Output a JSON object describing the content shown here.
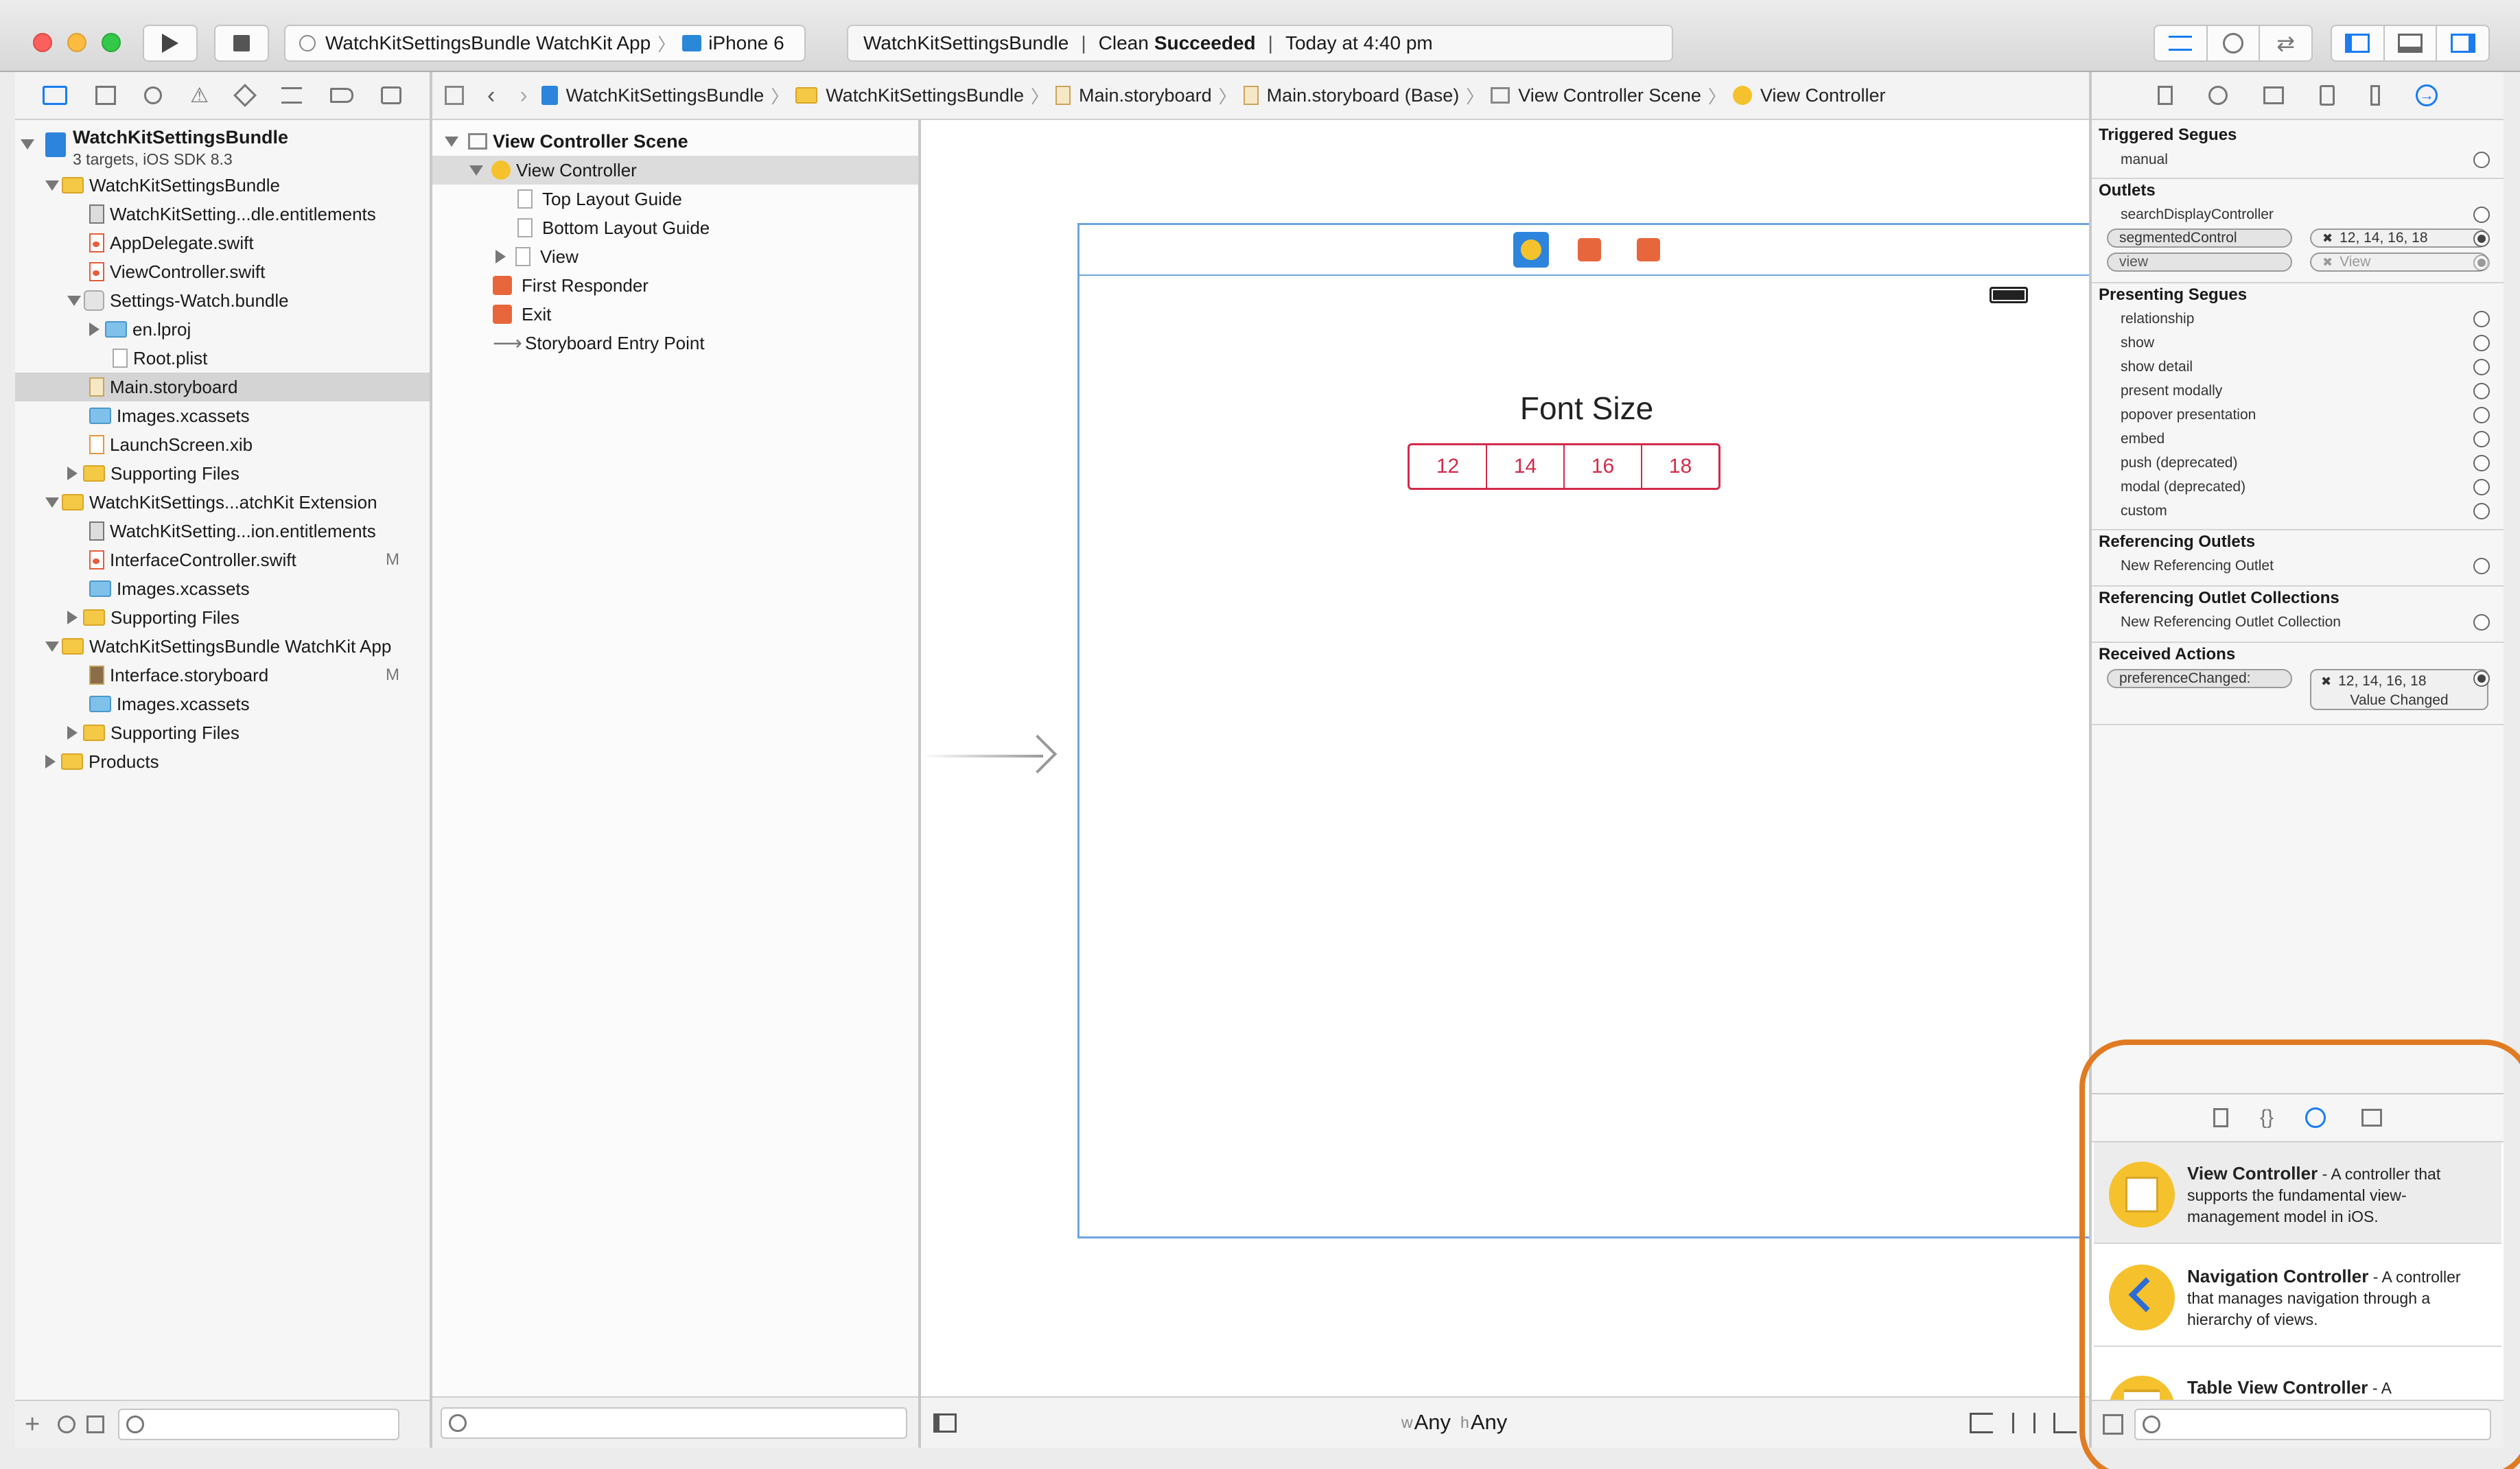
{
  "toolbar": {
    "scheme": "WatchKitSettingsBundle WatchKit App",
    "device": "iPhone 6",
    "status_project": "WatchKitSettingsBundle",
    "status_prefix": "Clean",
    "status_result": "Succeeded",
    "status_time": "Today at 4:40 pm"
  },
  "navigator": {
    "project_name": "WatchKitSettingsBundle",
    "project_subtitle": "3 targets, iOS SDK 8.3",
    "items": [
      {
        "label": "WatchKitSettingsBundle",
        "icon": "folder-icon"
      },
      {
        "label": "WatchKitSetting...dle.entitlements",
        "icon": "entitlements-icon"
      },
      {
        "label": "AppDelegate.swift",
        "icon": "swift-file-icon"
      },
      {
        "label": "ViewController.swift",
        "icon": "swift-file-icon"
      },
      {
        "label": "Settings-Watch.bundle",
        "icon": "bundle-icon"
      },
      {
        "label": "en.lproj",
        "icon": "blue-folder-icon"
      },
      {
        "label": "Root.plist",
        "icon": "plist-icon"
      },
      {
        "label": "Main.storyboard",
        "icon": "storyboard-icon"
      },
      {
        "label": "Images.xcassets",
        "icon": "assets-icon"
      },
      {
        "label": "LaunchScreen.xib",
        "icon": "xib-icon"
      },
      {
        "label": "Supporting Files",
        "icon": "folder-icon"
      },
      {
        "label": "WatchKitSettings...atchKit Extension",
        "icon": "folder-icon"
      },
      {
        "label": "WatchKitSetting...ion.entitlements",
        "icon": "entitlements-icon"
      },
      {
        "label": "InterfaceController.swift",
        "icon": "swift-file-icon",
        "badge": "M"
      },
      {
        "label": "Images.xcassets",
        "icon": "assets-icon"
      },
      {
        "label": "Supporting Files",
        "icon": "folder-icon"
      },
      {
        "label": "WatchKitSettingsBundle WatchKit App",
        "icon": "folder-icon"
      },
      {
        "label": "Interface.storyboard",
        "icon": "storyboard-icon",
        "badge": "M"
      },
      {
        "label": "Images.xcassets",
        "icon": "assets-icon"
      },
      {
        "label": "Supporting Files",
        "icon": "folder-icon"
      },
      {
        "label": "Products",
        "icon": "folder-icon"
      }
    ]
  },
  "breadcrumb": [
    "WatchKitSettingsBundle",
    "WatchKitSettingsBundle",
    "Main.storyboard",
    "Main.storyboard (Base)",
    "View Controller Scene",
    "View Controller"
  ],
  "outline": {
    "scene": "View Controller Scene",
    "items": [
      "View Controller",
      "Top Layout Guide",
      "Bottom Layout Guide",
      "View",
      "First Responder",
      "Exit",
      "Storyboard Entry Point"
    ]
  },
  "canvas": {
    "label": "Font Size",
    "segments": [
      "12",
      "14",
      "16",
      "18"
    ],
    "size_class_w": "w",
    "size_class_w_value": "Any",
    "size_class_h": "h",
    "size_class_h_value": "Any"
  },
  "inspector": {
    "triggered_segues": "Triggered Segues",
    "manual": "manual",
    "outlets": "Outlets",
    "outlet_1": "searchDisplayController",
    "outlet_2": "segmentedControl",
    "outlet_2_target": "12, 14, 16, 18",
    "outlet_3": "view",
    "outlet_3_target": "View",
    "presenting_segues": "Presenting Segues",
    "segues": [
      "relationship",
      "show",
      "show detail",
      "present modally",
      "popover presentation",
      "embed",
      "push (deprecated)",
      "modal (deprecated)",
      "custom"
    ],
    "referencing_outlets": "Referencing Outlets",
    "new_ref_outlet": "New Referencing Outlet",
    "referencing_collections": "Referencing Outlet Collections",
    "new_ref_collection": "New Referencing Outlet Collection",
    "received_actions": "Received Actions",
    "action_name": "preferenceChanged:",
    "action_target": "12, 14, 16, 18",
    "action_event": "Value Changed"
  },
  "library": [
    {
      "title": "View Controller",
      "desc": " - A controller that supports the fundamental view-management model in iOS."
    },
    {
      "title": "Navigation Controller",
      "desc": " - A controller that manages navigation through a hierarchy of views."
    },
    {
      "title": "Table View Controller",
      "desc": " - A"
    }
  ],
  "colors": {
    "accent": "#1a7cf0",
    "segment": "#d22a4a",
    "highlight": "#e07b22"
  }
}
